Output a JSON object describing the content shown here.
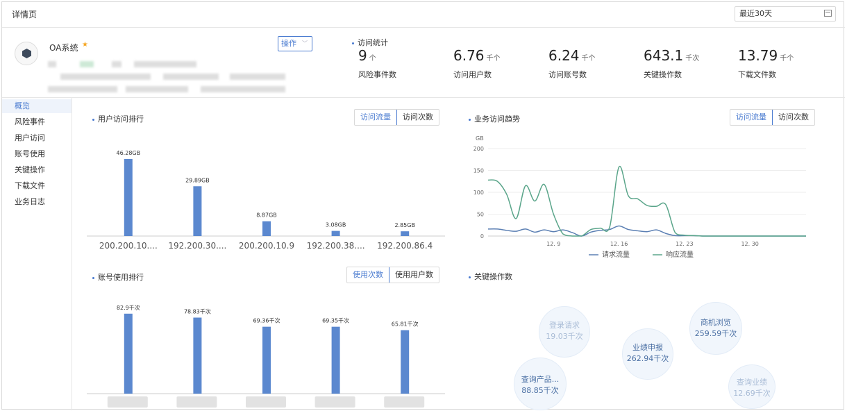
{
  "page_title": "详情页",
  "date_range": "最近30天",
  "system": {
    "name": "OA系统",
    "actions_label": "操作"
  },
  "stats": {
    "title": "访问统计",
    "items": [
      {
        "value": "9",
        "unit": "个",
        "label": "风险事件数"
      },
      {
        "value": "6.76",
        "unit": "千个",
        "label": "访问用户数"
      },
      {
        "value": "6.24",
        "unit": "千个",
        "label": "访问账号数"
      },
      {
        "value": "643.1",
        "unit": "千次",
        "label": "关键操作数"
      },
      {
        "value": "13.79",
        "unit": "千个",
        "label": "下载文件数"
      }
    ]
  },
  "sidebar": {
    "items": [
      {
        "label": "概览",
        "active": true
      },
      {
        "label": "风险事件"
      },
      {
        "label": "用户访问"
      },
      {
        "label": "账号使用"
      },
      {
        "label": "关键操作"
      },
      {
        "label": "下载文件"
      },
      {
        "label": "业务日志"
      }
    ]
  },
  "user_rank": {
    "title": "用户访问排行",
    "tabs": [
      "访问流量",
      "访问次数"
    ],
    "active_tab": 0
  },
  "account_rank": {
    "title": "账号使用排行",
    "tabs": [
      "使用次数",
      "使用用户数"
    ],
    "active_tab": 0
  },
  "trend": {
    "title": "业务访问趋势",
    "tabs": [
      "访问流量",
      "访问次数"
    ],
    "active_tab": 0
  },
  "key_ops": {
    "title": "关键操作数",
    "bubbles": [
      {
        "name": "登录请求",
        "value": "19.03千次",
        "faint": true
      },
      {
        "name": "业绩申报",
        "value": "262.94千次"
      },
      {
        "name": "商机浏览",
        "value": "259.59千次"
      },
      {
        "name": "查询产品...",
        "value": "88.85千次"
      },
      {
        "name": "查询业绩",
        "value": "12.69千次",
        "faint": true
      }
    ]
  },
  "colors": {
    "accent": "#4a7bd0",
    "bar": "#5b88cf",
    "request": "#5b7fb3",
    "response": "#5aa58a"
  },
  "chart_data": [
    {
      "type": "bar",
      "title": "用户访问排行",
      "categories": [
        "200.200.10....",
        "192.200.30....",
        "200.200.10.9",
        "192.200.38....",
        "192.200.86.4"
      ],
      "values": [
        46.28,
        29.89,
        8.87,
        3.08,
        2.85
      ],
      "value_labels": [
        "46.28GB",
        "29.89GB",
        "8.87GB",
        "3.08GB",
        "2.85GB"
      ],
      "ylim": [
        0,
        55
      ]
    },
    {
      "type": "bar",
      "title": "账号使用排行",
      "values": [
        82.9,
        78.83,
        69.36,
        69.35,
        65.81
      ],
      "value_labels": [
        "82.9千次",
        "78.83千次",
        "69.36千次",
        "69.35千次",
        "65.81千次"
      ],
      "ylim": [
        0,
        95
      ]
    },
    {
      "type": "line",
      "title": "业务访问趋势",
      "y_unit": "GB",
      "ylim": [
        0,
        200
      ],
      "yticks": [
        0,
        50,
        100,
        150,
        200
      ],
      "xlim": [
        1,
        35
      ],
      "xticks": [
        {
          "x": 8,
          "label": "12. 9"
        },
        {
          "x": 15,
          "label": "12. 16"
        },
        {
          "x": 22,
          "label": "12. 23"
        },
        {
          "x": 29,
          "label": "12. 30"
        }
      ],
      "grid": true,
      "legend": "bottom",
      "series": [
        {
          "name": "请求流量",
          "x": [
            1,
            2,
            3,
            4,
            5,
            6,
            7,
            8,
            9,
            10,
            11,
            12,
            13,
            14,
            15,
            16,
            17,
            18,
            19,
            20,
            21,
            22,
            23,
            24,
            25,
            26,
            27,
            28,
            29,
            30,
            31,
            32,
            33,
            34,
            35
          ],
          "y": [
            16,
            16,
            13,
            11,
            16,
            9,
            14,
            10,
            14,
            8,
            0,
            9,
            13,
            15,
            23,
            15,
            12,
            10,
            14,
            6,
            1,
            1,
            1,
            0,
            0,
            0,
            0,
            0,
            0,
            0,
            0,
            0,
            0,
            0,
            0
          ]
        },
        {
          "name": "响应流量",
          "x": [
            1,
            2,
            3,
            4,
            5,
            6,
            7,
            8,
            9,
            10,
            11,
            12,
            13,
            14,
            15,
            16,
            17,
            18,
            19,
            20,
            21,
            22,
            23,
            24,
            25,
            26,
            27,
            28,
            29,
            30,
            31,
            32,
            33,
            34,
            35
          ],
          "y": [
            128,
            125,
            95,
            40,
            115,
            80,
            118,
            50,
            5,
            0,
            0,
            15,
            18,
            20,
            158,
            92,
            85,
            70,
            68,
            72,
            8,
            2,
            1,
            0,
            0,
            0,
            0,
            0,
            0,
            0,
            0,
            0,
            0,
            0,
            0
          ]
        }
      ]
    }
  ]
}
